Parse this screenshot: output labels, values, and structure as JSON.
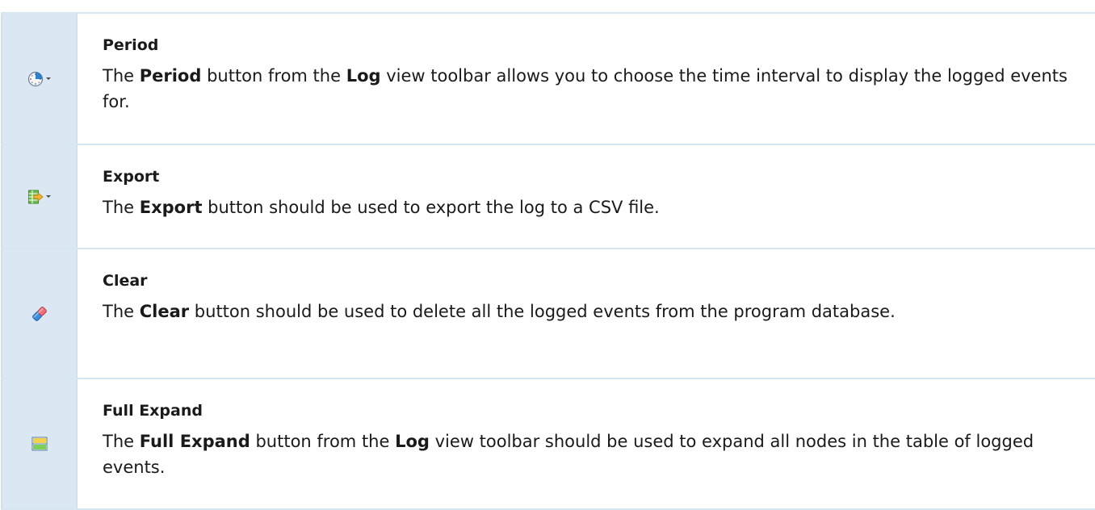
{
  "rows": [
    {
      "icon": "clock-dropdown-icon",
      "title": "Period",
      "text": [
        {
          "t": "The ",
          "b": false
        },
        {
          "t": "Period",
          "b": true
        },
        {
          "t": " button from the ",
          "b": false
        },
        {
          "t": "Log",
          "b": true
        },
        {
          "t": " view toolbar allows you to choose the time interval to display the logged events for.",
          "b": false
        }
      ]
    },
    {
      "icon": "export-dropdown-icon",
      "title": "Export",
      "text": [
        {
          "t": "The ",
          "b": false
        },
        {
          "t": "Export",
          "b": true
        },
        {
          "t": " button should be used to export the log to a CSV file.",
          "b": false
        }
      ]
    },
    {
      "icon": "eraser-icon",
      "title": "Clear",
      "text": [
        {
          "t": "The ",
          "b": false
        },
        {
          "t": "Clear",
          "b": true
        },
        {
          "t": " button should be used to delete all the logged events from the program database.",
          "b": false
        }
      ]
    },
    {
      "icon": "full-expand-icon",
      "title": "Full Expand",
      "text": [
        {
          "t": "The ",
          "b": false
        },
        {
          "t": "Full Expand",
          "b": true
        },
        {
          "t": " button from the ",
          "b": false
        },
        {
          "t": "Log",
          "b": true
        },
        {
          "t": " view toolbar should be used to expand all nodes in the table of logged events.",
          "b": false
        }
      ]
    }
  ]
}
